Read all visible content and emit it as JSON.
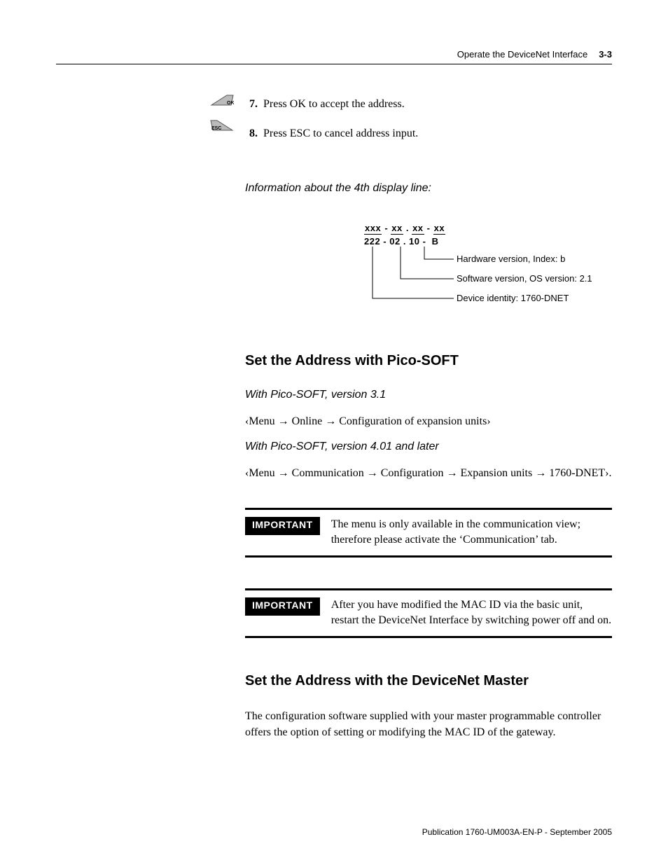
{
  "header": {
    "section_title": "Operate the DeviceNet Interface",
    "page_number": "3-3"
  },
  "steps": [
    {
      "n": "7.",
      "text": "Press OK to accept the address."
    },
    {
      "n": "8.",
      "text": "Press ESC to cancel address input."
    }
  ],
  "info_heading": "Information about the 4th display line:",
  "diagram": {
    "mask": "xxx - xx . xx - xx",
    "sample": "222 - 02 . 10 -  B",
    "callouts": {
      "hw": "Hardware version, Index: b",
      "sw": "Software version, OS version: 2.1",
      "id": "Device identity: 1760-DNET"
    }
  },
  "section1": {
    "heading": "Set the Address with Pico-SOFT",
    "sub1": "With Pico-SOFT, version 3.1",
    "path1": "‹Menu → Online → Configuration of expansion units›",
    "sub2": "With Pico-SOFT, version 4.01 and later",
    "path2": "‹Menu → Communication → Configuration → Expansion units → 1760-DNET›."
  },
  "important1": {
    "label": "IMPORTANT",
    "text": "The menu is only available in the communication view; therefore please activate the ‘Communication’ tab."
  },
  "important2": {
    "label": "IMPORTANT",
    "text": "After you have modified the MAC ID via the basic unit, restart the DeviceNet Interface by switching power off and on."
  },
  "section2": {
    "heading": "Set the Address with the DeviceNet Master",
    "body": "The configuration software supplied with your master programmable controller offers the option of setting or modifying the MAC ID of the gateway."
  },
  "footer": "Publication 1760-UM003A-EN-P - September 2005",
  "icons": {
    "ok": "OK",
    "esc": "ESC"
  }
}
